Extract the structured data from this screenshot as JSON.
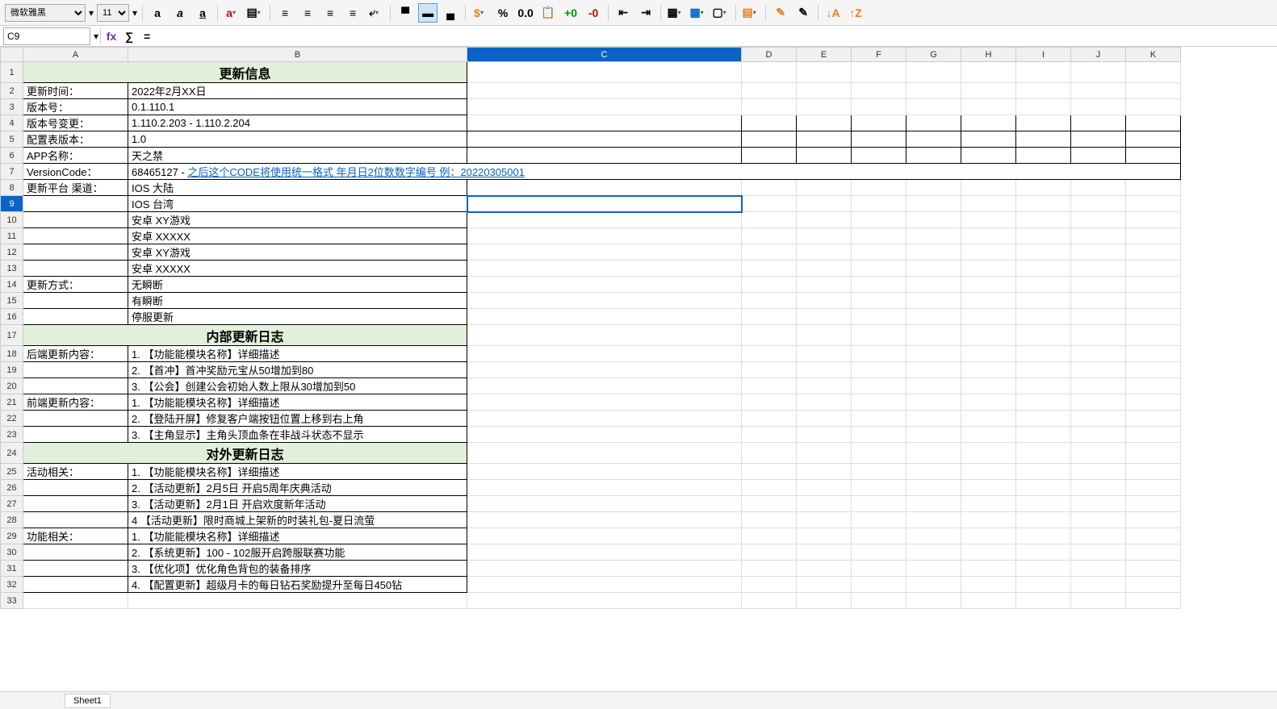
{
  "toolbar": {
    "font_name": "微软雅黑",
    "font_size": "11"
  },
  "namebox": {
    "ref": "C9"
  },
  "columns": [
    "A",
    "B",
    "C",
    "D",
    "E",
    "F",
    "G",
    "H",
    "I",
    "J",
    "K"
  ],
  "rowcount": 33,
  "selected": {
    "row": 9,
    "col": "C"
  },
  "tab": "Sheet1",
  "sections": {
    "s1": "更新信息",
    "s2": "内部更新日志",
    "s3": "对外更新日志"
  },
  "cells": {
    "r2a": "更新时间：",
    "r2b": "2022年2月XX日",
    "r3a": "版本号：",
    "r3b": "0.1.110.1",
    "r4a": "版本号变更：",
    "r4b": "1.110.2.203 - 1.110.2.204",
    "r5a": "配置表版本：",
    "r5b": "1.0",
    "r6a": "APP名称：",
    "r6b": "天之禁",
    "r7a": "VersionCode：",
    "r7b_plain": "68465127 - ",
    "r7b_link": "之后这个CODE将使用统一格式 年月日2位数数字编号 例：20220305001",
    "r8a": "更新平台 渠道：",
    "r8b": "IOS  大陆",
    "r9b": "IOS  台湾",
    "r10b": "安卓  XY游戏",
    "r11b": "安卓  XXXXX",
    "r12b": "安卓  XY游戏",
    "r13b": "安卓  XXXXX",
    "r14a": "更新方式：",
    "r14b": "无瞬断",
    "r15b": "有瞬断",
    "r16b": "停服更新",
    "r18a": "后端更新内容：",
    "r18b": "1. 【功能能模块名称】详细描述",
    "r19b": "2. 【首冲】首冲奖励元宝从50增加到80",
    "r20b": "3. 【公会】创建公会初始人数上限从30增加到50",
    "r21a": "前端更新内容：",
    "r21b": "1. 【功能能模块名称】详细描述",
    "r22b": "2. 【登陆开屏】修复客户端按钮位置上移到右上角",
    "r23b": "3. 【主角显示】主角头顶血条在非战斗状态不显示",
    "r25a": "活动相关：",
    "r25b": "1. 【功能能模块名称】详细描述",
    "r26b": "2. 【活动更新】2月5日 开启5周年庆典活动",
    "r27b": "3. 【活动更新】2月1日 开启欢度新年活动",
    "r28b": "4  【活动更新】限时商城上架新的时装礼包-夏日流萤",
    "r29a": "功能相关：",
    "r29b": "1. 【功能能模块名称】详细描述",
    "r30b": "2. 【系统更新】100 - 102服开启跨服联赛功能",
    "r31b": "3. 【优化项】优化角色背包的装备排序",
    "r32b": "4. 【配置更新】超级月卡的每日钻石奖励提升至每日450钻"
  }
}
